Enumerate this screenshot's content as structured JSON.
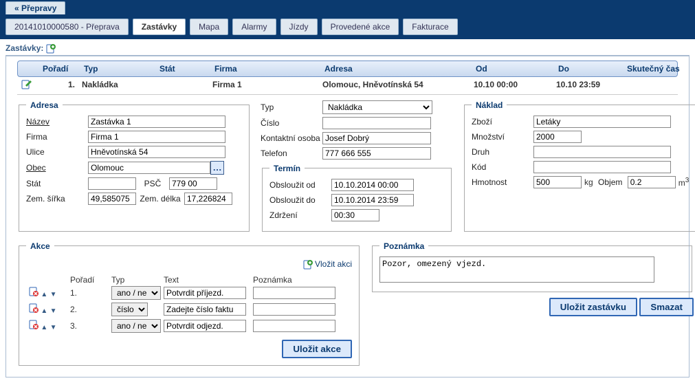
{
  "crumb_back": "« Přepravy",
  "tabs": [
    {
      "label": "20141010000580 - Přeprava",
      "active": false
    },
    {
      "label": "Zastávky",
      "active": true
    },
    {
      "label": "Mapa",
      "active": false
    },
    {
      "label": "Alarmy",
      "active": false
    },
    {
      "label": "Jízdy",
      "active": false
    },
    {
      "label": "Provedené akce",
      "active": false
    },
    {
      "label": "Fakturace",
      "active": false
    }
  ],
  "subhead_label": "Zastávky:",
  "table": {
    "headers": {
      "poradi": "Pořadí",
      "typ": "Typ",
      "stat": "Stát",
      "firma": "Firma",
      "adresa": "Adresa",
      "od": "Od",
      "do": "Do",
      "skutecny": "Skutečný čas"
    },
    "rows": [
      {
        "poradi": "1.",
        "typ": "Nakládka",
        "stat": "",
        "firma": "Firma 1",
        "adresa": "Olomouc, Hněvotínská 54",
        "od": "10.10 00:00",
        "do": "10.10 23:59",
        "skutecny": ""
      }
    ]
  },
  "adresa": {
    "legend": "Adresa",
    "fields": {
      "nazev_lbl": "Název",
      "nazev": "Zastávka 1",
      "firma_lbl": "Firma",
      "firma": "Firma 1",
      "ulice_lbl": "Ulice",
      "ulice": "Hněvotínská 54",
      "obec_lbl": "Obec",
      "obec": "Olomouc",
      "stat_lbl": "Stát",
      "stat": "",
      "psc_lbl": "PSČ",
      "psc": "779 00",
      "sirka_lbl": "Zem. šířka",
      "sirka": "49,585075",
      "delka_lbl": "Zem. délka",
      "delka": "17,226824"
    }
  },
  "typblk": {
    "typ_lbl": "Typ",
    "typ": "Nakládka",
    "cislo_lbl": "Číslo",
    "cislo": "",
    "kontakt_lbl": "Kontaktní osoba",
    "kontakt": "Josef Dobrý",
    "telefon_lbl": "Telefon",
    "telefon": "777 666 555"
  },
  "termin": {
    "legend": "Termín",
    "od_lbl": "Obsloužit od",
    "od": "10.10.2014 00:00",
    "do_lbl": "Obsloužit do",
    "do": "10.10.2014 23:59",
    "zdrzeni_lbl": "Zdržení",
    "zdrzeni": "00:30"
  },
  "naklad": {
    "legend": "Náklad",
    "zbozi_lbl": "Zboží",
    "zbozi": "Letáky",
    "mnozstvi_lbl": "Množství",
    "mnozstvi": "2000",
    "druh_lbl": "Druh",
    "druh": "",
    "kod_lbl": "Kód",
    "kod": "",
    "hmotnost_lbl": "Hmotnost",
    "hmotnost": "500",
    "hmotnost_unit": "kg",
    "objem_lbl": "Objem",
    "objem": "0.2",
    "objem_unit": "m"
  },
  "akce": {
    "legend": "Akce",
    "add_label": "Vložit akci",
    "save_label": "Uložit akce",
    "headers": {
      "poradi": "Pořadí",
      "typ": "Typ",
      "text": "Text",
      "pozn": "Poznámka"
    },
    "rows": [
      {
        "poradi": "1.",
        "typ": "ano / ne",
        "text": "Potvrdit příjezd.",
        "pozn": ""
      },
      {
        "poradi": "2.",
        "typ": "číslo",
        "text": "Zadejte číslo faktu",
        "pozn": ""
      },
      {
        "poradi": "3.",
        "typ": "ano / ne",
        "text": "Potvrdit odjezd.",
        "pozn": ""
      }
    ]
  },
  "poznamka": {
    "legend": "Poznámka",
    "text": "Pozor, omezený vjezd."
  },
  "buttons": {
    "save_stop": "Uložit zastávku",
    "delete": "Smazat"
  }
}
